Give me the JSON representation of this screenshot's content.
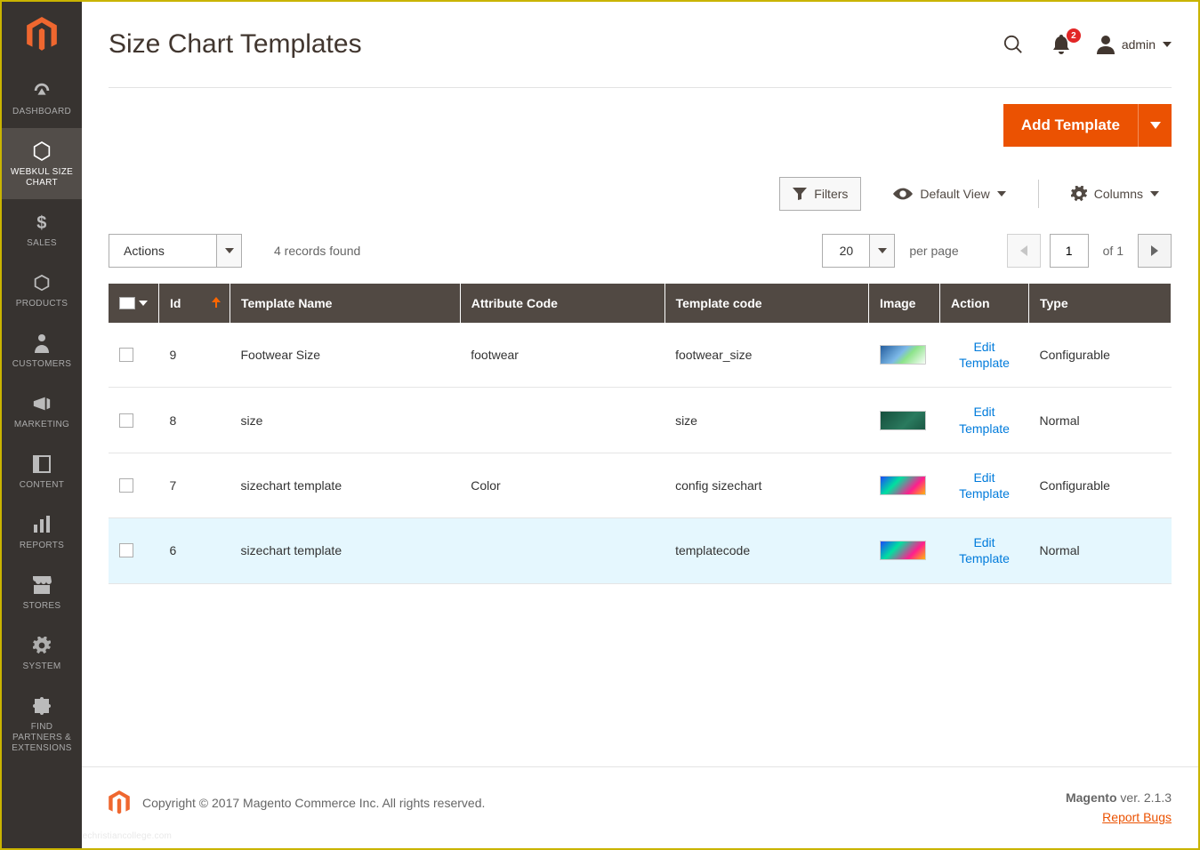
{
  "page": {
    "title": "Size Chart Templates"
  },
  "header": {
    "user_label": "admin",
    "notifications_count": "2"
  },
  "sidebar": {
    "items": [
      {
        "label": "DASHBOARD"
      },
      {
        "label": "WEBKUL SIZE CHART"
      },
      {
        "label": "SALES"
      },
      {
        "label": "PRODUCTS"
      },
      {
        "label": "CUSTOMERS"
      },
      {
        "label": "MARKETING"
      },
      {
        "label": "CONTENT"
      },
      {
        "label": "REPORTS"
      },
      {
        "label": "STORES"
      },
      {
        "label": "SYSTEM"
      },
      {
        "label": "FIND PARTNERS & EXTENSIONS"
      }
    ]
  },
  "buttons": {
    "add_template": "Add Template"
  },
  "toolbar": {
    "filters": "Filters",
    "default_view": "Default View",
    "columns": "Columns"
  },
  "controls": {
    "actions": "Actions",
    "records_found": "4 records found",
    "page_size": "20",
    "per_page": "per page",
    "page": "1",
    "page_of": "of 1"
  },
  "grid": {
    "headers": {
      "id": "Id",
      "template_name": "Template Name",
      "attribute_code": "Attribute Code",
      "template_code": "Template code",
      "image": "Image",
      "action": "Action",
      "type": "Type"
    },
    "action_label": "Edit Template",
    "rows": [
      {
        "id": "9",
        "name": "Footwear Size",
        "attr": "footwear",
        "code": "footwear_size",
        "thumb": "a",
        "type": "Configurable"
      },
      {
        "id": "8",
        "name": "size",
        "attr": "",
        "code": "size",
        "thumb": "b",
        "type": "Normal"
      },
      {
        "id": "7",
        "name": "sizechart template",
        "attr": "Color",
        "code": "config sizechart",
        "thumb": "c",
        "type": "Configurable"
      },
      {
        "id": "6",
        "name": "sizechart template",
        "attr": "",
        "code": "templatecode",
        "thumb": "c",
        "type": "Normal"
      }
    ]
  },
  "footer": {
    "copyright": "Copyright © 2017 Magento Commerce Inc. All rights reserved.",
    "product": "Magento",
    "version_label": " ver. 2.1.3",
    "report_bugs": "Report Bugs"
  },
  "watermark": "www.heritagechristiancollege.com"
}
